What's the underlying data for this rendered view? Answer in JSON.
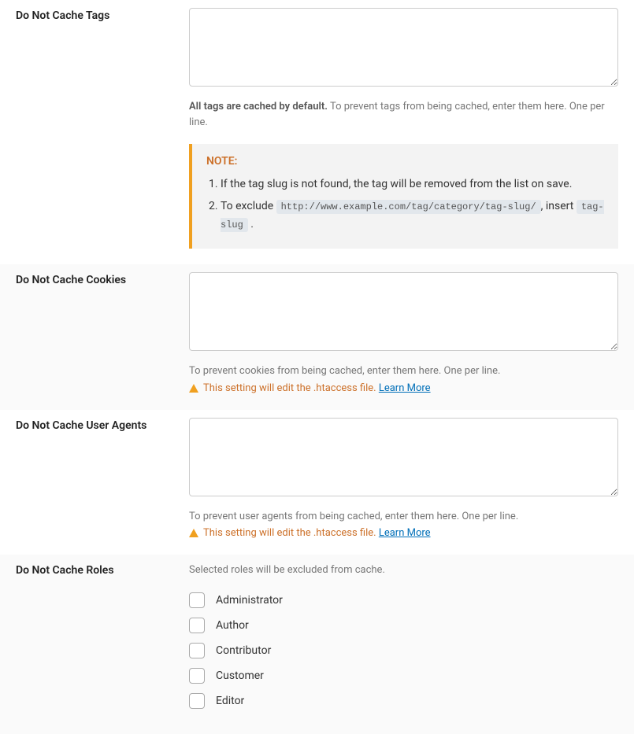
{
  "sections": {
    "tags": {
      "label": "Do Not Cache Tags",
      "help_bold": "All tags are cached by default.",
      "help_rest": " To prevent tags from being cached, enter them here. One per line.",
      "note_title": "NOTE:",
      "note_item1": "If the tag slug is not found, the tag will be removed from the list on save.",
      "note_item2_pre": "To exclude ",
      "note_item2_code1": "http://www.example.com/tag/category/tag-slug/",
      "note_item2_mid": ", insert ",
      "note_item2_code2": "tag-slug",
      "note_item2_post": " ."
    },
    "cookies": {
      "label": "Do Not Cache Cookies",
      "help": "To prevent cookies from being cached, enter them here. One per line.",
      "warning": "This setting will edit the .htaccess file.",
      "learn_more": "Learn More"
    },
    "user_agents": {
      "label": "Do Not Cache User Agents",
      "help": "To prevent user agents from being cached, enter them here. One per line.",
      "warning": "This setting will edit the .htaccess file.",
      "learn_more": "Learn More"
    },
    "roles": {
      "label": "Do Not Cache Roles",
      "help": "Selected roles will be excluded from cache.",
      "items": [
        "Administrator",
        "Author",
        "Contributor",
        "Customer",
        "Editor"
      ]
    }
  }
}
